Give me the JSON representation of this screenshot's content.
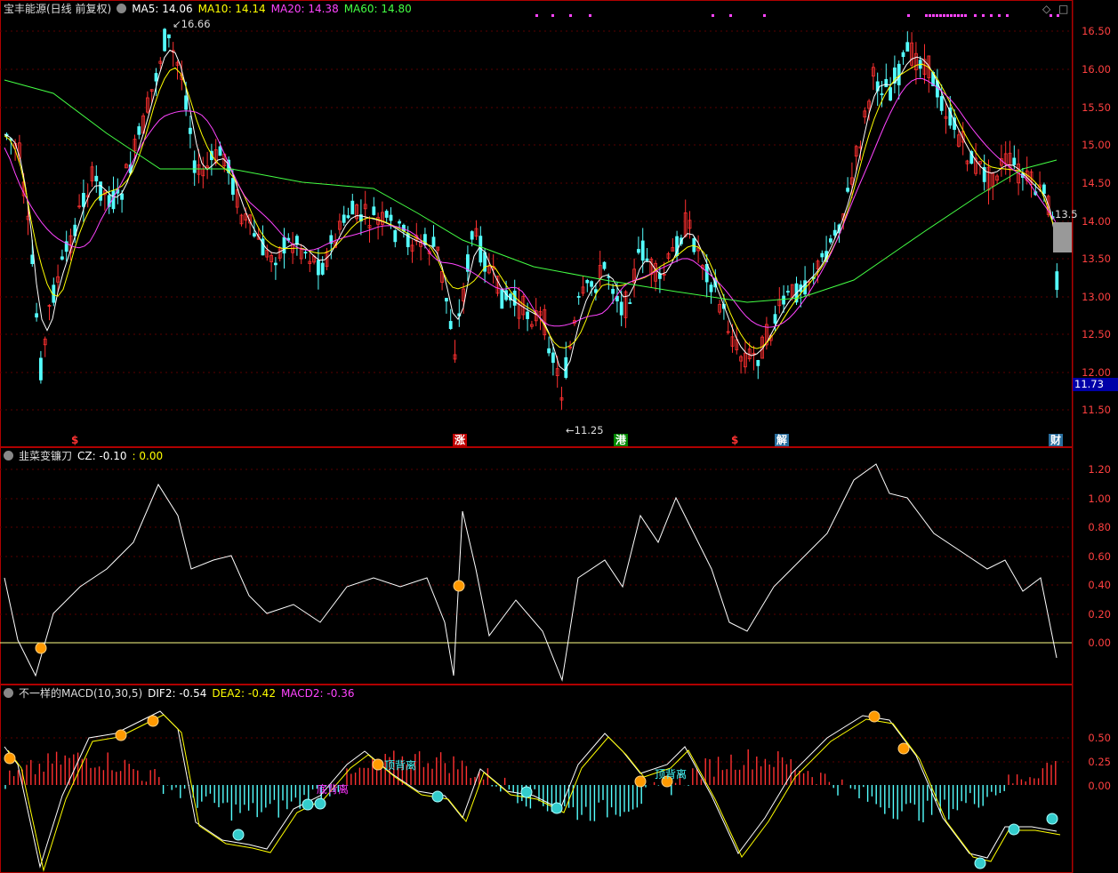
{
  "main_panel": {
    "title": "宝丰能源(日线 前复权)",
    "ma": [
      {
        "label": "MA5: 14.06",
        "color": "#ffffff"
      },
      {
        "label": "MA10: 14.14",
        "color": "#ffff00"
      },
      {
        "label": "MA20: 14.38",
        "color": "#ff44ff"
      },
      {
        "label": "MA60: 14.80",
        "color": "#44ff44"
      }
    ],
    "high_label": "16.66",
    "low_label": "11.25",
    "last_price_label": "13.5",
    "current_price": "11.73",
    "axis": [
      "16.50",
      "16.00",
      "15.50",
      "15.00",
      "14.50",
      "14.00",
      "13.50",
      "13.00",
      "12.50",
      "12.00",
      "11.50"
    ],
    "event_markers": [
      {
        "text": "$",
        "color": "#ff3333",
        "bg": "transparent"
      },
      {
        "text": "涨",
        "color": "#ffffff",
        "bg": "#c00000"
      },
      {
        "text": "港",
        "color": "#ffffff",
        "bg": "#008800"
      },
      {
        "text": "$",
        "color": "#ff3333",
        "bg": "transparent"
      },
      {
        "text": "解",
        "color": "#ffffff",
        "bg": "#2a6f9f"
      },
      {
        "text": "财",
        "color": "#ffffff",
        "bg": "#2a6f9f"
      }
    ]
  },
  "cz_panel": {
    "title": "韭菜变镰刀",
    "cz_label": "CZ: -0.10",
    "zero_label": ": 0.00",
    "axis": [
      "1.20",
      "1.00",
      "0.80",
      "0.60",
      "0.40",
      "0.20",
      "0.00"
    ]
  },
  "macd_panel": {
    "title": "不一样的MACD(10,30,5)",
    "dif_label": "DIF2: -0.54",
    "dea_label": "DEA2: -0.42",
    "macd_label": "MACD2: -0.36",
    "axis": [
      "0.50",
      "0.25",
      "0.00"
    ],
    "annotations": [
      "顶背离",
      "顶背离",
      "底背离"
    ]
  },
  "colors": {
    "up": "#ff3030",
    "down": "#54ffff",
    "ma5": "#ffffff",
    "ma10": "#ffff00",
    "ma20": "#ff44ff",
    "ma60": "#44ff44",
    "axis_text": "#ff4040",
    "frame": "#b00000"
  }
}
